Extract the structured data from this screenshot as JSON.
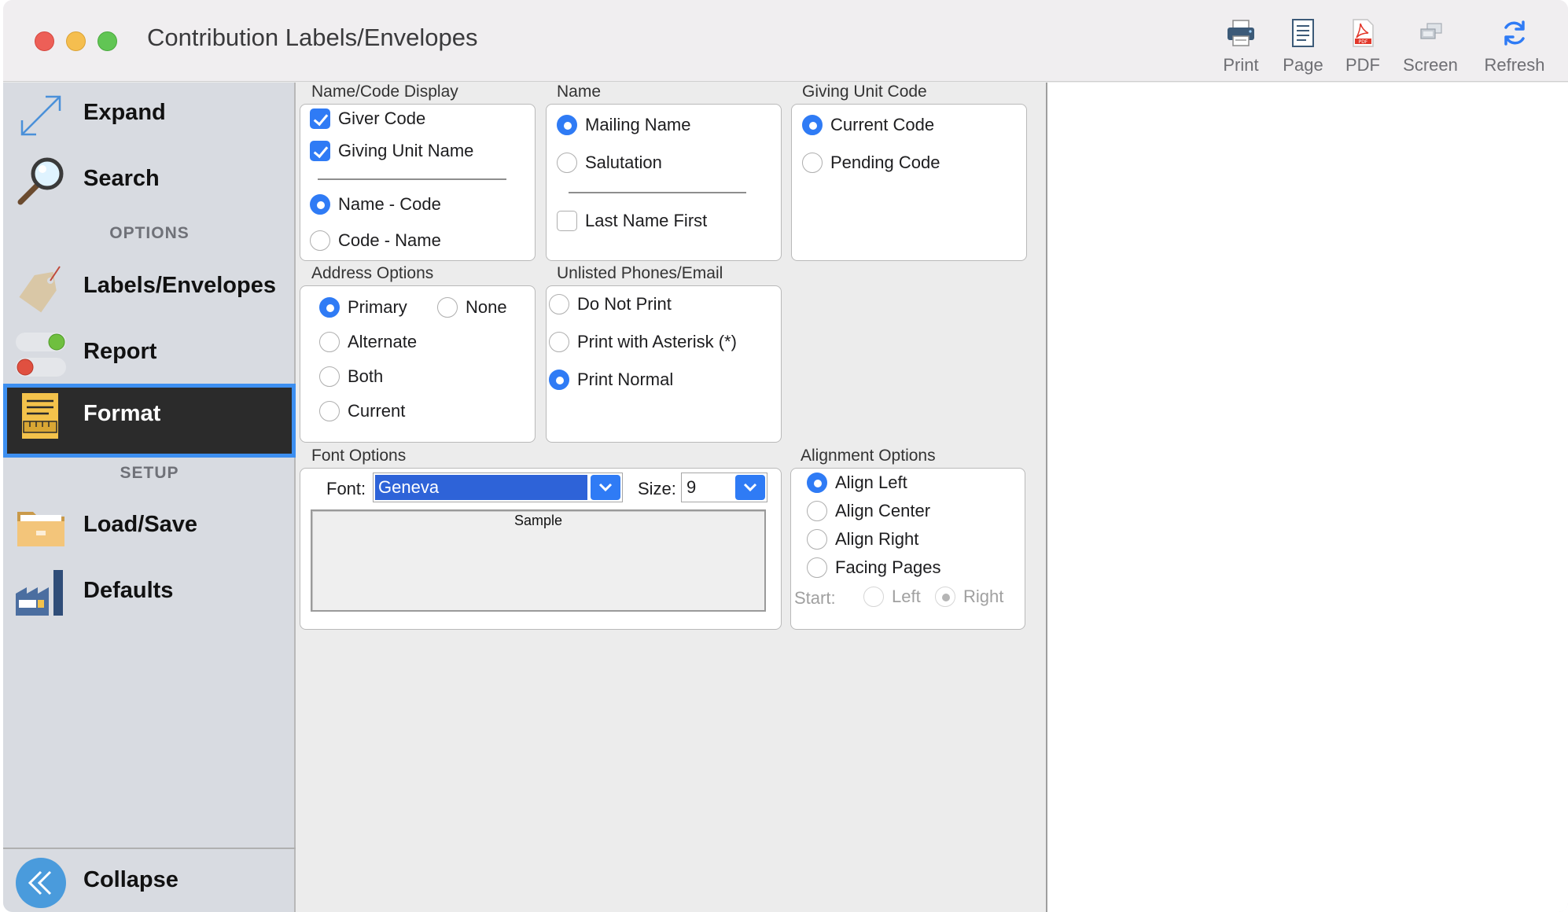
{
  "window": {
    "title": "Contribution Labels/Envelopes"
  },
  "toolbar": {
    "print": "Print",
    "page": "Page",
    "pdf": "PDF",
    "screen": "Screen",
    "refresh": "Refresh"
  },
  "sidebar": {
    "expand": "Expand",
    "search": "Search",
    "options_header": "OPTIONS",
    "labels_envelopes": "Labels/Envelopes",
    "report": "Report",
    "format": "Format",
    "setup_header": "SETUP",
    "load_save": "Load/Save",
    "defaults": "Defaults",
    "collapse": "Collapse"
  },
  "name_code_display": {
    "title": "Name/Code Display",
    "giver_code": "Giver Code",
    "giving_unit_name": "Giving Unit Name",
    "name_code": "Name - Code",
    "code_name": "Code - Name"
  },
  "name": {
    "title": "Name",
    "mailing_name": "Mailing Name",
    "salutation": "Salutation",
    "last_name_first": "Last Name First"
  },
  "giving_unit_code": {
    "title": "Giving Unit Code",
    "current_code": "Current Code",
    "pending_code": "Pending Code"
  },
  "address_options": {
    "title": "Address Options",
    "primary": "Primary",
    "none": "None",
    "alternate": "Alternate",
    "both": "Both",
    "current": "Current"
  },
  "unlisted": {
    "title": "Unlisted Phones/Email",
    "do_not_print": "Do Not Print",
    "print_asterisk": "Print with Asterisk (*)",
    "print_normal": "Print Normal"
  },
  "font_options": {
    "title": "Font Options",
    "font_label": "Font:",
    "font_value": "Geneva",
    "size_label": "Size:",
    "size_value": "9",
    "sample": "Sample"
  },
  "alignment": {
    "title": "Alignment Options",
    "align_left": "Align Left",
    "align_center": "Align Center",
    "align_right": "Align Right",
    "facing_pages": "Facing Pages",
    "start_label": "Start:",
    "left": "Left",
    "right": "Right"
  },
  "colors": {
    "accent": "#2f7bf5",
    "active_bg": "#2b2b2b",
    "active_border": "#3d8ff0"
  }
}
